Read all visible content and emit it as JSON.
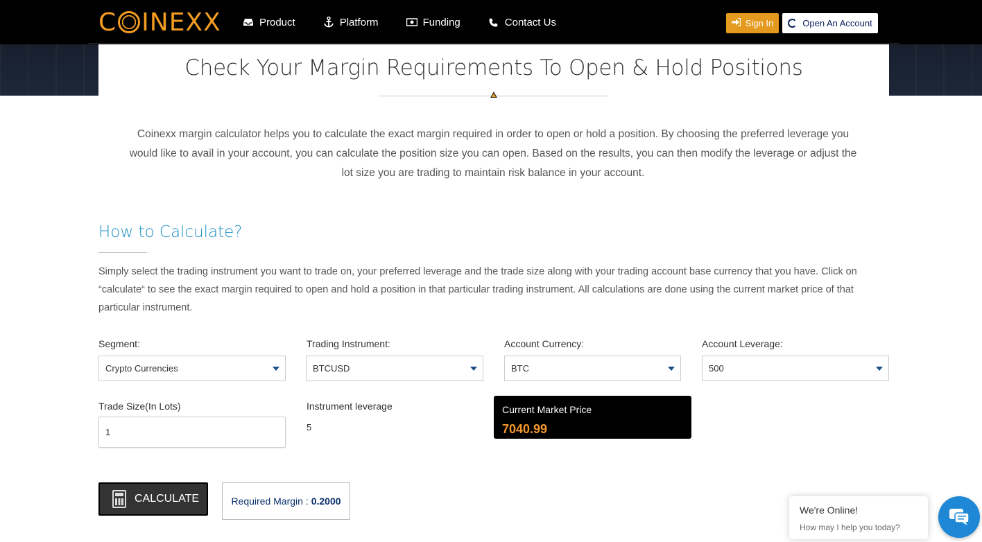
{
  "brand": {
    "logo_text_left": "C",
    "logo_text_right": "INEXX",
    "accent": "#f39c22"
  },
  "nav": {
    "items": [
      {
        "label": "Product",
        "icon": "inbox-icon"
      },
      {
        "label": "Platform",
        "icon": "anchor-icon"
      },
      {
        "label": "Funding",
        "icon": "money-icon"
      },
      {
        "label": "Contact Us",
        "icon": "phone-icon"
      }
    ],
    "signin_label": "Sign In",
    "open_account_label": "Open An Account"
  },
  "page": {
    "title": "Check Your Margin Requirements To Open & Hold Positions",
    "intro": "Coinexx margin calculator helps you to calculate the exact margin required in order to open or hold a position. By choosing the preferred leverage you would like to avail in your account, you can calculate the position size you can open. Based on the results, you can then modify the leverage or adjust the lot size you are trading to maintain risk balance in your account."
  },
  "how_to": {
    "title": "How to Calculate?",
    "text": "Simply select the trading instrument you want to trade on, your preferred leverage and the trade size along with your trading account base currency that you have. Click on “calculate“ to see the exact margin required to open and hold a position in that particular trading instrument. All calculations are done using the current market price of that particular instrument."
  },
  "form": {
    "segment": {
      "label": "Segment:",
      "value": "Crypto Currencies"
    },
    "instrument": {
      "label": "Trading Instrument:",
      "value": "BTCUSD"
    },
    "currency": {
      "label": "Account Currency:",
      "value": "BTC"
    },
    "leverage": {
      "label": "Account Leverage:",
      "value": "500"
    },
    "trade_size": {
      "label": "Trade Size(In Lots)",
      "value": "1"
    },
    "instrument_leverage": {
      "label": "Instrument leverage",
      "value": "5"
    },
    "market_price": {
      "label": "Current Market Price",
      "value": "7040.99"
    },
    "calculate_label": "CALCULATE",
    "result_label": "Required Margin :",
    "result_value": "0.2000"
  },
  "chat": {
    "title": "We're Online!",
    "subtitle": "How may I help you today?",
    "color": "#1e88d6"
  }
}
